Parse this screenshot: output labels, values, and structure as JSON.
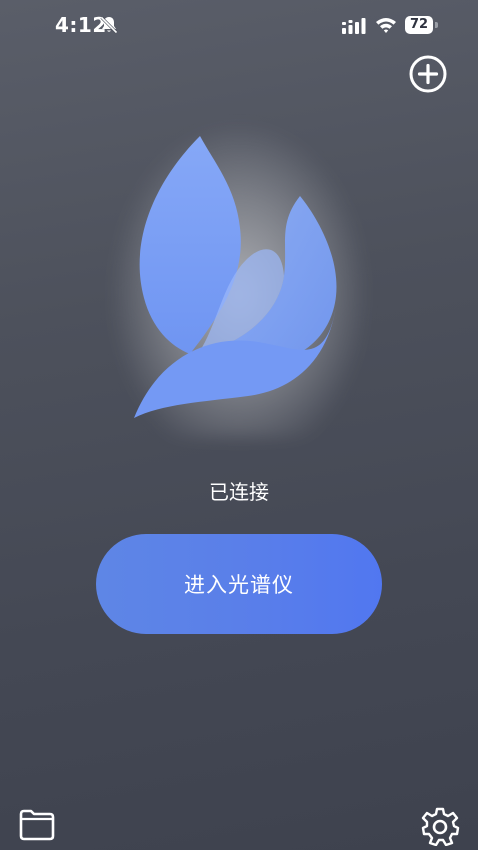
{
  "status_bar": {
    "time": "4:12",
    "battery_level": "72",
    "icons": [
      "bell-off-icon",
      "signal-icon",
      "wifi-icon",
      "battery-icon"
    ]
  },
  "header": {
    "add_icon": "plus-circle-icon"
  },
  "main": {
    "logo_icon": "flame-bird-logo",
    "connection_status": "已连接",
    "enter_button_label": "进入光谱仪"
  },
  "bottom": {
    "left_icon": "folder-icon",
    "right_icon": "gear-icon"
  },
  "colors": {
    "background_top": "#5a5e69",
    "background_bottom": "#3e424e",
    "accent": "#5a7fe9",
    "logo": "#7aa0f5"
  }
}
